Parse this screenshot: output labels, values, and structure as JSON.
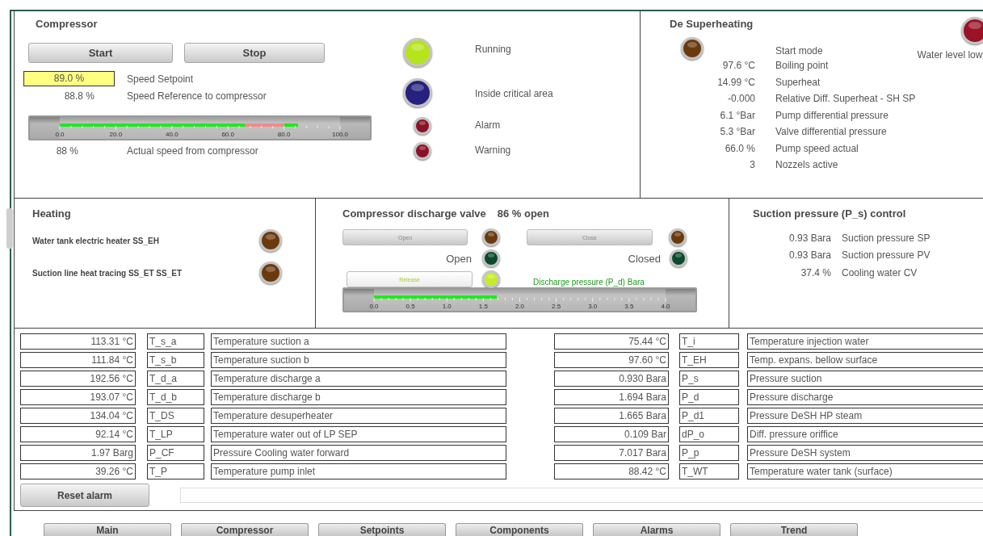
{
  "compressor": {
    "title": "Compressor",
    "buttons": [
      "Start",
      "Stop"
    ],
    "setpoint": {
      "value": "89.0 %",
      "label": "Speed Setpoint"
    },
    "reference": {
      "value": "88.8 %",
      "label": "Speed Reference to compressor"
    },
    "gauge": {
      "ticks": [
        "0.0",
        "20.0",
        "40.0",
        "60.0",
        "80.0",
        "100.0"
      ],
      "level": 0.85,
      "band": [
        {
          "level": 0.66
        },
        {
          "level": 0.8
        }
      ]
    },
    "actual": {
      "value": "88 %",
      "label": "Actual speed from compressor"
    },
    "indicators": [
      {
        "label": "Running",
        "color": "#b5e31c",
        "kind": "large"
      },
      {
        "label": "Inside critical area",
        "color": "#26207e",
        "kind": "large"
      },
      {
        "label": "Alarm",
        "color": "#8a1224",
        "kind": "small"
      },
      {
        "label": "Warning",
        "color": "#8a1224",
        "kind": "small"
      }
    ]
  },
  "desuperheating": {
    "title": "De Superheating",
    "start_mode": {
      "label": "Start mode",
      "color": "#6a3a0e"
    },
    "water_level": {
      "label": "Water level low",
      "color": "#9a1226"
    },
    "readings": [
      {
        "value": "97.6 °C",
        "label": "Boiling point"
      },
      {
        "value": "14.99 °C",
        "label": "Superheat"
      },
      {
        "value": "-0.000",
        "label": "Relative Diff. Superheat - SH SP"
      },
      {
        "value": "6.1 °Bar",
        "label": "Pump differential pressure"
      },
      {
        "value": "5.3 °Bar",
        "label": "Valve differential pressure"
      },
      {
        "value": "66.0 %",
        "label": "Pump speed actual"
      },
      {
        "value": "3",
        "label": "Nozzels active"
      }
    ]
  },
  "heating": {
    "title": "Heating",
    "items": [
      {
        "label": "Water tank electric heater SS_EH",
        "color": "#6a3a0e"
      },
      {
        "label": "Suction line heat tracing SS_ET SS_ET",
        "color": "#6a3a0e"
      }
    ]
  },
  "valve": {
    "title": "Compressor discharge valve",
    "opening": "86 % open",
    "open_button": {
      "label": "Open",
      "color": "#6a3a0e"
    },
    "close_button": {
      "label": "Close",
      "color": "#6a3a0e"
    },
    "open_state": {
      "label": "Open",
      "color": "#0b4a2c"
    },
    "closed_state": {
      "label": "Closed",
      "color": "#0b4a2c"
    },
    "release_button": {
      "label": "Release",
      "color": "#c6ec2a"
    },
    "gauge_label": "Discharge pressure (P_d) Bara",
    "gauge": {
      "ticks": [
        "0.0",
        "0.5",
        "1.0",
        "1.5",
        "2.0",
        "2.5",
        "3.0",
        "3.5",
        "4.0"
      ],
      "level": 0.42
    }
  },
  "suction": {
    "title": "Suction pressure (P_s) control",
    "readings": [
      {
        "value": "0.93 Bara",
        "label": "Suction pressure SP"
      },
      {
        "value": "0.93 Bara",
        "label": "Suction pressure PV"
      },
      {
        "value": "37.4 %",
        "label": "Cooling water CV"
      }
    ]
  },
  "table_left": [
    {
      "value": "113.31 °C",
      "tag": "T_s_a",
      "description": "Temperature suction a"
    },
    {
      "value": "111.84 °C",
      "tag": "T_s_b",
      "description": "Temperature suction b"
    },
    {
      "value": "192.56 °C",
      "tag": "T_d_a",
      "description": "Temperature discharge a"
    },
    {
      "value": "193.07 °C",
      "tag": "T_d_b",
      "description": "Temperature discharge b"
    },
    {
      "value": "134.04 °C",
      "tag": "T_DS",
      "description": "Temperature desuperheater"
    },
    {
      "value": "92.14 °C",
      "tag": "T_LP",
      "description": "Temperature water out of LP SEP"
    },
    {
      "value": "1.97 Barg",
      "tag": "P_CF",
      "description": "Pressure Cooling water forward"
    },
    {
      "value": "39.26 °C",
      "tag": "T_P",
      "description": "Temperature pump inlet"
    }
  ],
  "table_right": [
    {
      "value": "75.44 °C",
      "tag": "T_i",
      "description": "Temperature injection water"
    },
    {
      "value": "97.60 °C",
      "tag": "T_EH",
      "description": "Temp. expans. bellow surface"
    },
    {
      "value": "0.930 Bara",
      "tag": "P_s",
      "description": "Pressure suction"
    },
    {
      "value": "1.694 Bara",
      "tag": "P_d",
      "description": "Pressure discharge"
    },
    {
      "value": "1.665 Bara",
      "tag": "P_d1",
      "description": "Pressure DeSH HP steam"
    },
    {
      "value": "0.109 Bar",
      "tag": "dP_o",
      "description": "Diff. pressure oriffice"
    },
    {
      "value": "7.017 Bara",
      "tag": "P_p",
      "description": "Pressure DeSH system"
    },
    {
      "value": "88.42 °C",
      "tag": "T_WT",
      "description": "Temperature water tank (surface)"
    }
  ],
  "reset_button": "Reset alarm",
  "navigation": [
    "Main",
    "Compressor",
    "Setpoints",
    "Components",
    "Alarms",
    "Trend"
  ]
}
